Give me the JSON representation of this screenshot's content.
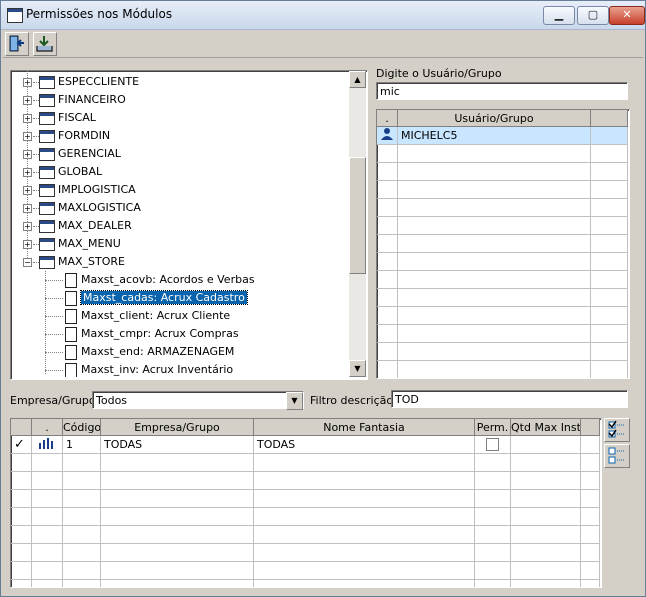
{
  "window": {
    "title": "Permissões nos Módulos",
    "min_label": "▁",
    "max_label": "▢",
    "close_label": "✕"
  },
  "tree": {
    "items": [
      {
        "label": "ESPECCLIENTE",
        "type": "group"
      },
      {
        "label": "FINANCEIRO",
        "type": "group"
      },
      {
        "label": "FISCAL",
        "type": "group"
      },
      {
        "label": "FORMDIN",
        "type": "group"
      },
      {
        "label": "GERENCIAL",
        "type": "group"
      },
      {
        "label": "GLOBAL",
        "type": "group"
      },
      {
        "label": "IMPLOGISTICA",
        "type": "group"
      },
      {
        "label": "MAXLOGISTICA",
        "type": "group"
      },
      {
        "label": "MAX_DEALER",
        "type": "group"
      },
      {
        "label": "MAX_MENU",
        "type": "group"
      },
      {
        "label": "MAX_STORE",
        "type": "group-open"
      },
      {
        "label": "Maxst_acovb: Acordos e Verbas",
        "type": "child"
      },
      {
        "label": "Maxst_cadas: Acrux Cadastro",
        "type": "child-selected"
      },
      {
        "label": "Maxst_client: Acrux Cliente",
        "type": "child"
      },
      {
        "label": "Maxst_cmpr: Acrux Compras",
        "type": "child"
      },
      {
        "label": "Maxst_end: ARMAZENAGEM",
        "type": "child"
      },
      {
        "label": "Maxst_inv: Acrux Inventário",
        "type": "child"
      }
    ]
  },
  "user_search": {
    "label": "Digite o Usuário/Grupo",
    "value": "mic"
  },
  "user_grid": {
    "col_dot": ".",
    "col_user": "Usuário/Grupo",
    "rows": [
      "MICHELC5"
    ]
  },
  "filters": {
    "empresa_label": "Empresa/Grupo:",
    "empresa_value": "Todos",
    "filtro_label": "Filtro descrição:",
    "filtro_value": "TOD"
  },
  "company_grid": {
    "headers": {
      "dot": ".",
      "codigo": "Código",
      "empresa": "Empresa/Grupo",
      "fantasia": "Nome Fantasia",
      "perm": "Perm.",
      "qtd": "Qtd Max Inst"
    },
    "rows": [
      {
        "codigo": "1",
        "empresa": "TODAS",
        "fantasia": "TODAS",
        "perm": false
      }
    ]
  },
  "colors": {
    "selection": "#0a64ad",
    "row_highlight": "#c8e6ff"
  }
}
